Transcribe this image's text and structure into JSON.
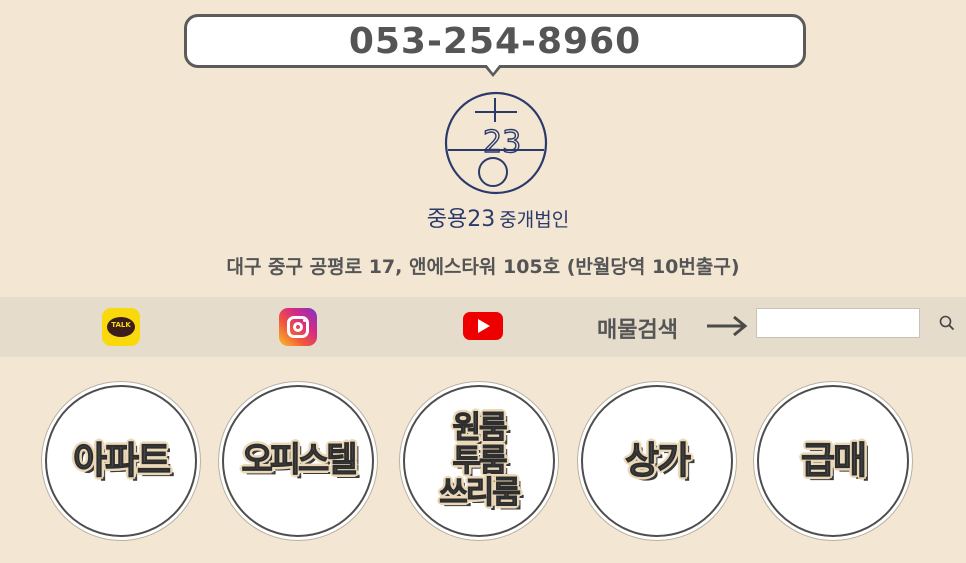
{
  "header": {
    "phone": "053-254-8960"
  },
  "logo": {
    "mark_text": "23",
    "brand": "중용23",
    "subtitle": "중개법인"
  },
  "address": "대구 중구 공평로 17, 앤에스타워 105호 (반월당역 10번출구)",
  "social": {
    "kakao_label": "TALK",
    "icons": [
      "kakao-talk-icon",
      "instagram-icon",
      "youtube-icon"
    ]
  },
  "search": {
    "label": "매물검색",
    "placeholder": ""
  },
  "categories": [
    {
      "label": "아파트"
    },
    {
      "label": "오피스텔"
    },
    {
      "label": "원룸\n투룸\n쓰리룸"
    },
    {
      "label": "상가"
    },
    {
      "label": "급매"
    }
  ],
  "colors": {
    "background": "#f3e7d4",
    "bar": "#e5dccb",
    "brand_navy": "#2b3a6b",
    "text_gray": "#555555"
  }
}
